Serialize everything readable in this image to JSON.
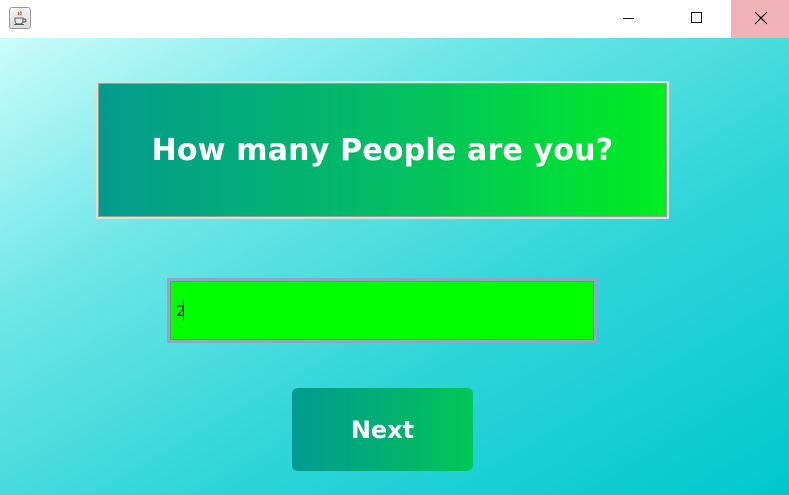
{
  "window": {
    "app_icon": "java-coffee-icon",
    "controls": {
      "minimize_icon": "minimize-icon",
      "maximize_icon": "maximize-icon",
      "close_icon": "close-icon"
    }
  },
  "question": {
    "text": "How many People are you?"
  },
  "people_input": {
    "value": "2"
  },
  "next_button": {
    "label": "Next"
  },
  "colors": {
    "input_background": "#00ff00",
    "close_hover": "#f1b3b8",
    "panel_gradient_start": "#049a8e",
    "panel_gradient_end": "#00ee20",
    "background_light": "#cafcfb",
    "background_dark": "#00c8cc"
  }
}
